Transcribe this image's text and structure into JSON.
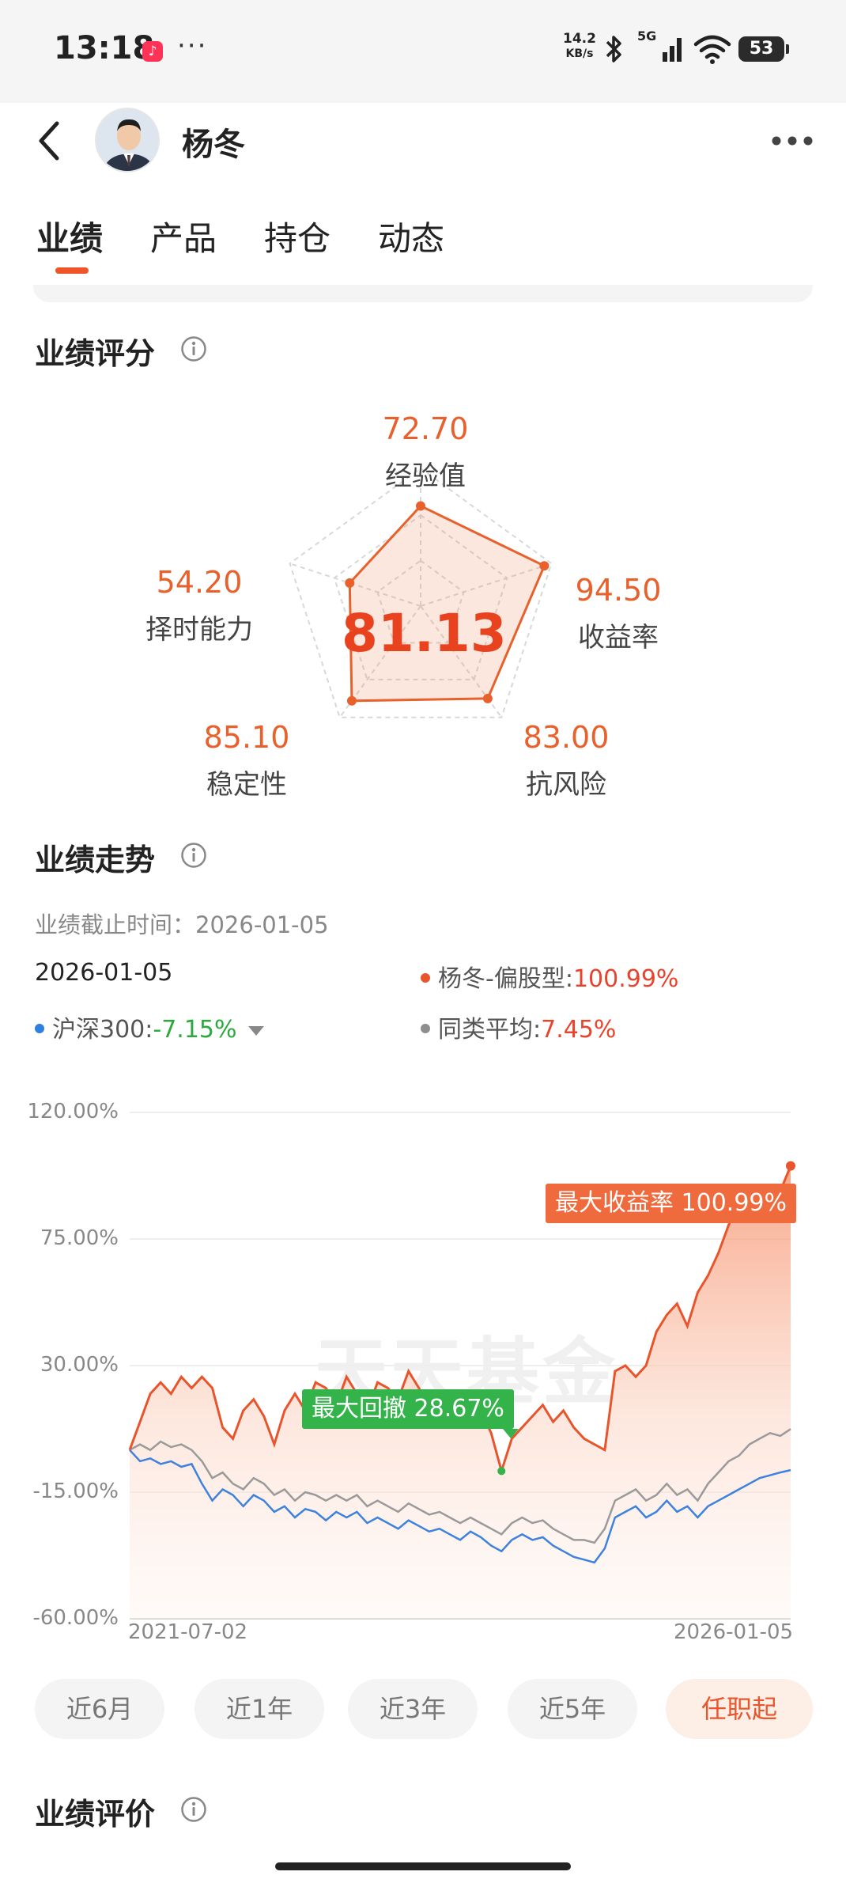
{
  "status_bar": {
    "time": "13:18",
    "net_speed_value": "14.2",
    "net_speed_unit": "KB/s",
    "signal": "5G",
    "battery": "53"
  },
  "header": {
    "name": "杨冬"
  },
  "tabs": [
    {
      "label": "业绩",
      "active": true
    },
    {
      "label": "产品",
      "active": false
    },
    {
      "label": "持仓",
      "active": false
    },
    {
      "label": "动态",
      "active": false
    }
  ],
  "score_section": {
    "title": "业绩评分",
    "total": "81.13",
    "dimensions": [
      {
        "label": "经验值",
        "value": "72.70"
      },
      {
        "label": "收益率",
        "value": "94.50"
      },
      {
        "label": "抗风险",
        "value": "83.00"
      },
      {
        "label": "稳定性",
        "value": "85.10"
      },
      {
        "label": "择时能力",
        "value": "54.20"
      }
    ]
  },
  "trend_section": {
    "title": "业绩走势",
    "cutoff_label": "业绩截止时间：",
    "cutoff_date": "2026-01-05",
    "current_date": "2026-01-05",
    "legend": [
      {
        "name": "杨冬-偏股型:",
        "value": "100.99%",
        "color": "#e8552c"
      },
      {
        "name": "沪深300:",
        "value": "-7.15%",
        "color": "#2f7fe0"
      },
      {
        "name": "同类平均:",
        "value": "7.45%",
        "color": "#8e8e8e"
      }
    ],
    "watermark": "天天基金"
  },
  "chart_data": {
    "type": "area",
    "x_start": "2021-07-02",
    "x_end": "2026-01-05",
    "xticks": [
      "2021-07-02",
      "2026-01-05"
    ],
    "yticks": [
      "120.00%",
      "75.00%",
      "30.00%",
      "-15.00%",
      "-60.00%"
    ],
    "ylim": [
      -60,
      120
    ],
    "annotations": {
      "max_return": "最大收益率 100.99%",
      "max_drawdown": "最大回撤 28.67%"
    },
    "series": [
      {
        "name": "杨冬-偏股型",
        "color": "#e8552c",
        "values": [
          0,
          10,
          20,
          24,
          20,
          26,
          22,
          26,
          22,
          8,
          4,
          14,
          18,
          12,
          2,
          14,
          20,
          14,
          24,
          22,
          16,
          26,
          20,
          14,
          24,
          22,
          18,
          28,
          22,
          16,
          20,
          18,
          12,
          16,
          14,
          6,
          -7.5,
          4,
          8,
          12,
          16,
          10,
          14,
          8,
          4,
          2,
          0,
          28,
          30,
          26,
          30,
          42,
          48,
          52,
          44,
          56,
          62,
          70,
          80,
          88,
          90,
          86,
          94,
          92,
          100.99
        ]
      },
      {
        "name": "沪深300",
        "color": "#2f7fe0",
        "values": [
          0,
          -4,
          -3,
          -5,
          -4,
          -6,
          -5,
          -12,
          -18,
          -14,
          -16,
          -20,
          -16,
          -18,
          -22,
          -20,
          -24,
          -21,
          -22,
          -25,
          -22,
          -24,
          -22,
          -26,
          -24,
          -26,
          -28,
          -25,
          -27,
          -29,
          -28,
          -30,
          -32,
          -29,
          -31,
          -34,
          -36,
          -32,
          -30,
          -32,
          -31,
          -34,
          -36,
          -38,
          -39,
          -40,
          -35,
          -24,
          -22,
          -20,
          -24,
          -22,
          -18,
          -22,
          -20,
          -24,
          -20,
          -18,
          -16,
          -14,
          -12,
          -10,
          -9,
          -8,
          -7.15
        ]
      },
      {
        "name": "同类平均",
        "color": "#8e8e8e",
        "values": [
          0,
          2,
          0,
          3,
          1,
          2,
          0,
          -4,
          -10,
          -8,
          -12,
          -14,
          -10,
          -12,
          -16,
          -14,
          -18,
          -15,
          -16,
          -18,
          -16,
          -18,
          -16,
          -20,
          -18,
          -20,
          -22,
          -19,
          -21,
          -23,
          -22,
          -24,
          -26,
          -24,
          -26,
          -28,
          -30,
          -26,
          -24,
          -26,
          -25,
          -28,
          -30,
          -32,
          -32,
          -33,
          -28,
          -18,
          -16,
          -14,
          -18,
          -16,
          -12,
          -16,
          -14,
          -18,
          -12,
          -8,
          -4,
          -2,
          2,
          4,
          6,
          5,
          7.45
        ]
      }
    ]
  },
  "range_buttons": [
    {
      "label": "近6月",
      "active": false
    },
    {
      "label": "近1年",
      "active": false
    },
    {
      "label": "近3年",
      "active": false
    },
    {
      "label": "近5年",
      "active": false
    },
    {
      "label": "任职起",
      "active": true
    }
  ],
  "evaluation_section": {
    "title": "业绩评价"
  }
}
